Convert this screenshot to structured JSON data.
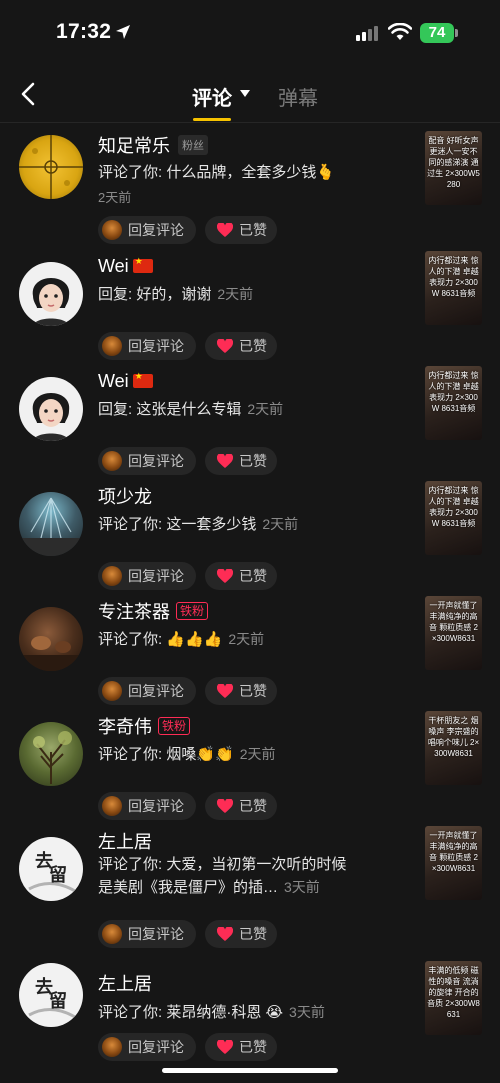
{
  "status_bar": {
    "time": "17:32",
    "battery": "74"
  },
  "header": {
    "tab_comments": "评论",
    "tab_danmaku": "弹幕"
  },
  "reply_label": "回复评论",
  "liked_label": "已赞",
  "colors": {
    "accent": "#f6c200",
    "like": "#fe2c55",
    "background": "#161616",
    "battery": "#34c759"
  },
  "comments": [
    {
      "name": "知足常乐",
      "badge": "粉丝",
      "text": "评论了你: 什么品牌，全套多少钱🫰",
      "time": "2天前",
      "thumb": "配音 好听女声更迷人一安不同的感涕演 通过生 2×300W5280"
    },
    {
      "name": "Wei",
      "flag": "CN",
      "text": "回复: 好的，谢谢",
      "time": "2天前",
      "thumb": "内行都过来 惊人的下潜 卓越表现力 2×300W 8631音频"
    },
    {
      "name": "Wei",
      "flag": "CN",
      "text": "回复: 这张是什么专辑",
      "time": "2天前",
      "thumb": "内行都过来 惊人的下潜 卓越表现力 2×300W 8631音频"
    },
    {
      "name": "项少龙",
      "text": "评论了你: 这一套多少钱",
      "time": "2天前",
      "thumb": "内行都过来 惊人的下潜 卓越表现力 2×300W 8631音频"
    },
    {
      "name": "专注茶器",
      "badge": "铁粉",
      "text": "评论了你: 👍👍👍",
      "time": "2天前",
      "thumb": "一开声就懂了 丰满纯净的高音 颗粒质感 2×300W8631"
    },
    {
      "name": "李奇伟",
      "badge": "铁粉",
      "text": "评论了你: 烟嗓👏👏",
      "time": "2天前",
      "thumb": "干杯朋友之 烟嗓声 李宗盛的 唱响个味儿 2×300W8631"
    },
    {
      "name": "左上居",
      "text": "评论了你: 大爱，当初第一次听的时候是美剧《我是僵尸》的插…",
      "time": "3天前",
      "thumb": "一开声就懂了 丰满纯净的高音 颗粒质感 2×300W8631"
    },
    {
      "name": "左上居",
      "text": "评论了你: 莱昂纳德·科恩 😭",
      "time": "3天前",
      "thumb": "丰满的低频 磁性的嗓音 流淌的旋律 开合的音质 2×300W8631"
    }
  ]
}
